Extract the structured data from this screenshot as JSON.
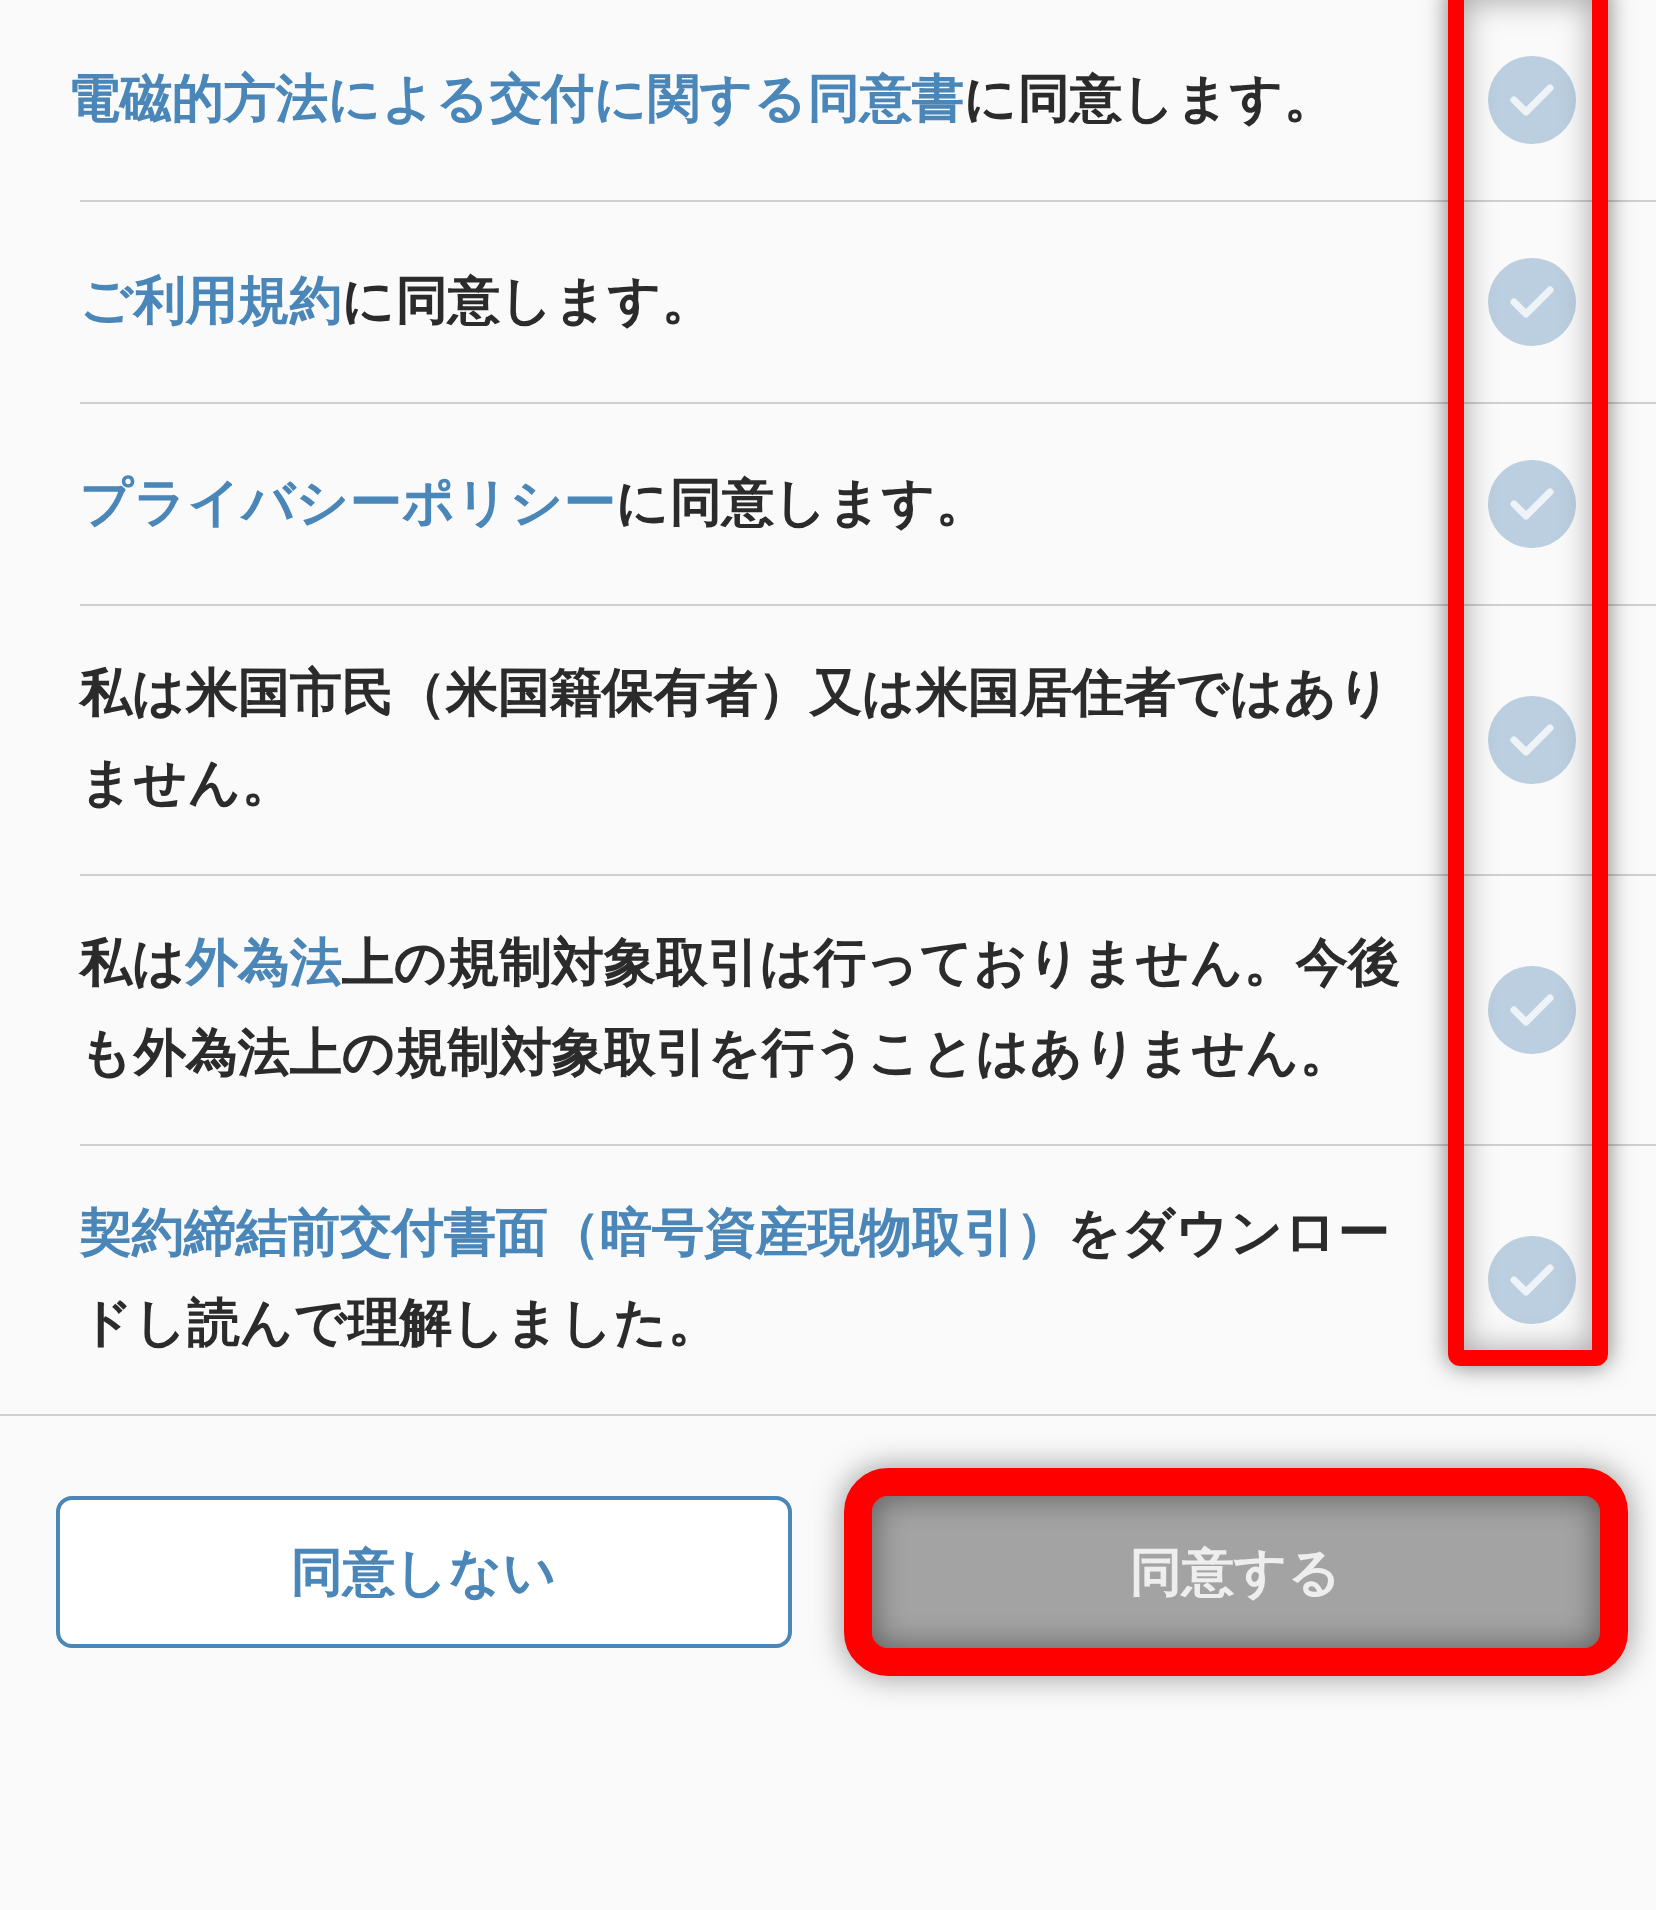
{
  "items": [
    {
      "segments": [
        {
          "text": "電磁的方法による交付に関する同意書",
          "kind": "link"
        },
        {
          "text": "に同意します。",
          "kind": "text"
        }
      ],
      "checked": false
    },
    {
      "segments": [
        {
          "text": "ご利用規約",
          "kind": "link"
        },
        {
          "text": "に同意します。",
          "kind": "text"
        }
      ],
      "checked": false
    },
    {
      "segments": [
        {
          "text": "プライバシーポリシー",
          "kind": "link"
        },
        {
          "text": "に同意します。",
          "kind": "text"
        }
      ],
      "checked": false
    },
    {
      "segments": [
        {
          "text": "私は米国市民（米国籍保有者）又は米国居住者ではありません。",
          "kind": "text"
        }
      ],
      "checked": false
    },
    {
      "segments": [
        {
          "text": "私は",
          "kind": "text"
        },
        {
          "text": "外為法",
          "kind": "link"
        },
        {
          "text": "上の規制対象取引は行っておりません。今後も外為法上の規制対象取引を行うことはありません。",
          "kind": "text"
        }
      ],
      "checked": false
    },
    {
      "segments": [
        {
          "text": "契約締結前交付書面（暗号資産現物取引）",
          "kind": "link"
        },
        {
          "text": "をダウンロードし読んで理解しました。",
          "kind": "text"
        }
      ],
      "checked": false
    }
  ],
  "buttons": [
    {
      "label": "同意しない",
      "kind": "secondary"
    },
    {
      "label": "同意する",
      "kind": "primary",
      "disabled": true
    }
  ],
  "highlight": {
    "checks_column": true,
    "agree_button": true
  }
}
